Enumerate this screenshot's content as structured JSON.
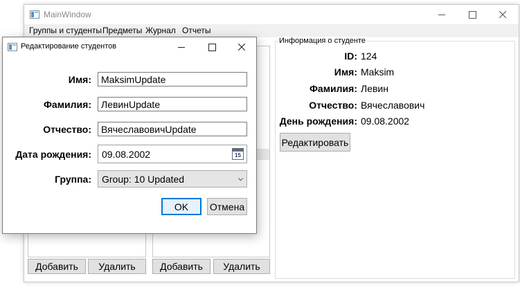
{
  "main": {
    "title": "MainWindow",
    "menu": [
      "Группы и студенты",
      "Предметы",
      "Журнал",
      "Отчеты"
    ],
    "left_buttons": {
      "add": "Добавить",
      "delete": "Удалить"
    },
    "middle_buttons": {
      "add": "Добавить",
      "delete": "Удалить"
    }
  },
  "student_info": {
    "legend": "Информация о студенте",
    "rows": [
      {
        "label": "ID:",
        "value": "124"
      },
      {
        "label": "Имя:",
        "value": "Maksim"
      },
      {
        "label": "Фамилия:",
        "value": "Левин"
      },
      {
        "label": "Отчество:",
        "value": "Вячеславович"
      },
      {
        "label": "День рождения:",
        "value": "09.08.2002"
      }
    ],
    "edit_button": "Редактировать"
  },
  "dialog": {
    "title": "Редактирование студентов",
    "labels": {
      "first_name": "Имя:",
      "last_name": "Фамилия:",
      "patronymic": "Отчество:",
      "birth_date": "Дата рождения:",
      "group": "Группа:"
    },
    "values": {
      "first_name": "MaksimUpdate",
      "last_name": "ЛевинUpdate",
      "patronymic": "ВячеславовичUpdate",
      "birth_date": "09.08.2002",
      "group": "Group: 10 Updated"
    },
    "calendar_day": "15",
    "ok_label": "OK",
    "cancel_label": "Отмена"
  },
  "icons": {
    "minimize": "minimize-icon",
    "maximize": "maximize-icon",
    "close": "close-icon",
    "calendar": "calendar-icon",
    "dropdown": "chevron-down-icon"
  }
}
